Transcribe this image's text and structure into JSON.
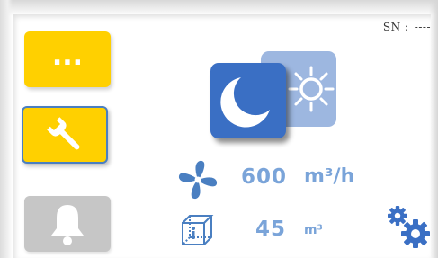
{
  "header": {
    "serial_label": "SN :",
    "serial_value": "----"
  },
  "sidebar": {
    "menu_button_label": "...",
    "settings_icon": "wrench-icon",
    "alarm_icon": "bell-icon"
  },
  "mode": {
    "night_icon": "moon-icon",
    "day_icon": "sun-icon"
  },
  "status": {
    "airflow_icon": "fan-icon",
    "airflow_value": "600",
    "airflow_unit": "m³/h",
    "volume_icon": "room-volume-icon",
    "volume_value": "45",
    "volume_unit": "m³"
  },
  "footer": {
    "config_icon": "gears-icon"
  },
  "colors": {
    "button_yellow": "#ffd000",
    "button_grey": "#c6c6c6",
    "accent_blue": "#3a6fc4",
    "light_blue": "#9db7e0",
    "text_blue": "#7aa4d9"
  }
}
